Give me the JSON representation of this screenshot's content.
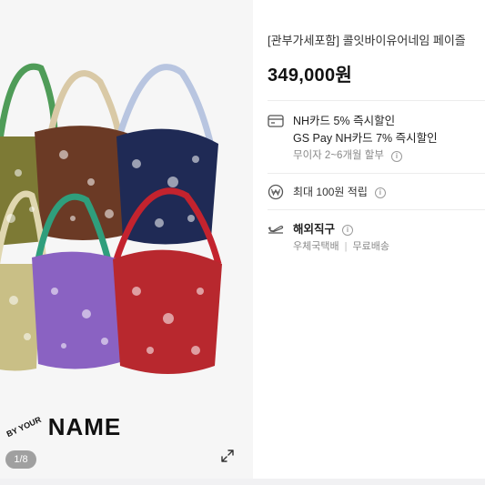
{
  "gallery": {
    "brand_mark": "BY YOUR",
    "brand_name": "NAME",
    "counter": "1/8",
    "expand_icon": "expand-diagonal-icon"
  },
  "product": {
    "title": "[관부가세포함] 콜잇바이유어네임 페이즐",
    "price": "349,000원"
  },
  "benefits": {
    "card_icon": "credit-card-icon",
    "card_line1": "NH카드 5% 즉시할인",
    "card_line2": "GS Pay NH카드 7% 즉시할인",
    "installment": "무이자 2~6개월 할부",
    "points_icon": "won-coin-icon",
    "points": "최대 100원 적립"
  },
  "shipping": {
    "icon": "airplane-icon",
    "title": "해외직구",
    "method": "우체국택배",
    "fee": "무료배송"
  },
  "colors": {
    "olive": "#7d7a35",
    "brown": "#6b3a25",
    "navy": "#1f2a55",
    "khaki": "#c9bf86",
    "purple": "#8a62c2",
    "red": "#b8282e"
  }
}
